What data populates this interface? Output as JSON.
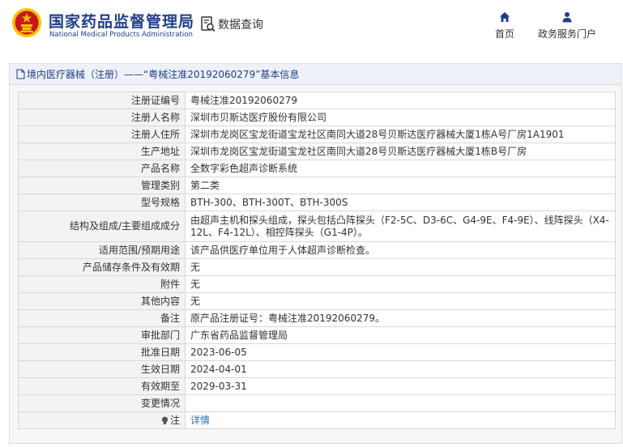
{
  "header": {
    "title": "国家药品监督管理局",
    "subtitle": "National Medical Products Administration",
    "query_label": "数据查询",
    "nav": {
      "home": "首页",
      "portal": "政务服务门户"
    }
  },
  "breadcrumb": {
    "text": "境内医疗器械（注册）——“粤械注准20192060279”基本信息"
  },
  "record": {
    "rows": [
      {
        "label": "注册证编号",
        "value": "粤械注准20192060279"
      },
      {
        "label": "注册人名称",
        "value": "深圳市贝斯达医疗股份有限公司"
      },
      {
        "label": "注册人住所",
        "value": "深圳市龙岗区宝龙街道宝龙社区南同大道28号贝斯达医疗器械大厦1栋A号厂房1A1901"
      },
      {
        "label": "生产地址",
        "value": "深圳市龙岗区宝龙街道宝龙社区南同大道28号贝斯达医疗器械大厦1栋B号厂房"
      },
      {
        "label": "产品名称",
        "value": "全数字彩色超声诊断系统"
      },
      {
        "label": "管理类别",
        "value": "第二类"
      },
      {
        "label": "型号规格",
        "value": "BTH-300、BTH-300T、BTH-300S"
      },
      {
        "label": "结构及组成/主要组成成分",
        "value": "由超声主机和探头组成，探头包括凸阵探头（F2-5C、D3-6C、G4-9E、F4-9E）、线阵探头（X4-12L、F4-12L）、相控阵探头（G1-4P）。"
      },
      {
        "label": "适用范围/预期用途",
        "value": "该产品供医疗单位用于人体超声诊断检查。"
      },
      {
        "label": "产品储存条件及有效期",
        "value": "无"
      },
      {
        "label": "附件",
        "value": "无"
      },
      {
        "label": "其他内容",
        "value": "无"
      },
      {
        "label": "备注",
        "value": "原产品注册证号：粤械注准20192060279。"
      },
      {
        "label": "审批部门",
        "value": "广东省药品监督管理局"
      },
      {
        "label": "批准日期",
        "value": "2023-06-05"
      },
      {
        "label": "生效日期",
        "value": "2024-04-01"
      },
      {
        "label": "有效期至",
        "value": "2029-03-31"
      },
      {
        "label": "变更情况",
        "value": ""
      }
    ],
    "note": {
      "label": "注",
      "link": "详情"
    }
  },
  "colors": {
    "brand_blue": "#1f3f8a",
    "link_blue": "#2b6cc4",
    "emblem_red": "#c8161d",
    "emblem_gold": "#f2c200"
  }
}
